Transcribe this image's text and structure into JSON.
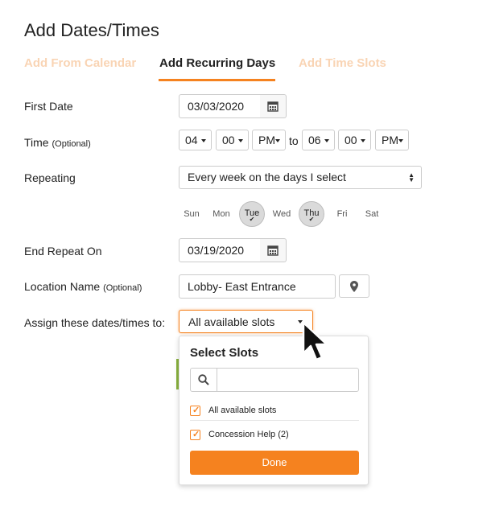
{
  "page": {
    "title": "Add Dates/Times"
  },
  "tabs": [
    {
      "label": "Add From Calendar",
      "active": false
    },
    {
      "label": "Add Recurring Days",
      "active": true
    },
    {
      "label": "Add Time Slots",
      "active": false
    }
  ],
  "form": {
    "first_date": {
      "label": "First Date",
      "value": "03/03/2020",
      "icon": "calendar-icon"
    },
    "time": {
      "label": "Time",
      "optional": "(Optional)",
      "start_hour": "04",
      "start_minute": "00",
      "start_ampm": "PM",
      "to": "to",
      "end_hour": "06",
      "end_minute": "00",
      "end_ampm": "PM"
    },
    "repeating": {
      "label": "Repeating",
      "value": "Every week on the days I select"
    },
    "days": [
      {
        "label": "Sun",
        "selected": false
      },
      {
        "label": "Mon",
        "selected": false
      },
      {
        "label": "Tue",
        "selected": true
      },
      {
        "label": "Wed",
        "selected": false
      },
      {
        "label": "Thu",
        "selected": true
      },
      {
        "label": "Fri",
        "selected": false
      },
      {
        "label": "Sat",
        "selected": false
      }
    ],
    "end_repeat": {
      "label": "End Repeat On",
      "value": "03/19/2020",
      "icon": "calendar-icon"
    },
    "location": {
      "label": "Location Name",
      "optional": "(Optional)",
      "value": "Lobby- East Entrance",
      "icon": "map-marker-icon"
    },
    "assign": {
      "label": "Assign these dates/times to:",
      "value": "All available slots"
    }
  },
  "slots_popup": {
    "title": "Select Slots",
    "search_placeholder": "",
    "options": [
      {
        "label": "All available slots",
        "checked": true
      },
      {
        "label": "Concession Help (2)",
        "checked": true
      }
    ],
    "done_label": "Done"
  },
  "colors": {
    "accent": "#f5821f",
    "tab_inactive": "#f9d4b4",
    "day_selected_bg": "#dadada",
    "green_edge": "#8ab33f"
  }
}
